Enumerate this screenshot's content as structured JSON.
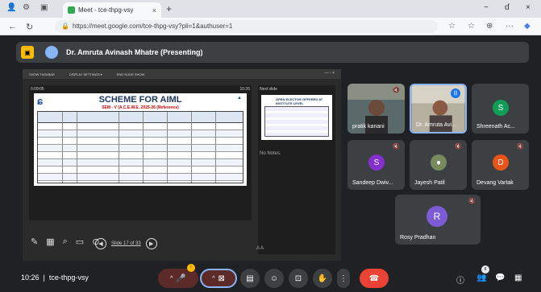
{
  "browser": {
    "tab_title": "Meet - tce-thpg-vsy",
    "tab_close": "×",
    "new_tab": "+",
    "url": "https://meet.google.com/tce-thpg-vsy?pli=1&authuser=1",
    "win_min": "−",
    "win_max": "ɗ",
    "win_close": "×"
  },
  "meet": {
    "presenting_title": "Dr. Amruta Avinash Mhatre (Presenting)",
    "share_toolbar": [
      "SHOW TASKBAR",
      "DISPLAY SETTINGS ▾",
      "END SLIDE SHOW"
    ],
    "slide_time_left": "0:09:05",
    "slide_time_right": "10:26",
    "slide_title": "SCHEME FOR AIML",
    "slide_subtitle": "SEM - V (A.C.E.W.E. 2025-26 (Reference)",
    "next_slide_label": "Next slide",
    "next_slide_title": "OPEN ELECTIVE OFFERED AT INSTITUTE LEVEL",
    "notes": "No Notes.",
    "slide_counter": "Slide 17 of 33",
    "participants": [
      {
        "name": "pratik kanani",
        "type": "video"
      },
      {
        "name": "Dr. Amruta Avi...",
        "type": "video"
      },
      {
        "name": "Shreenath Ac...",
        "initial": "S",
        "color": "#0f9d58"
      },
      {
        "name": "Sandeep Dwiv...",
        "initial": "S",
        "color": "#8430ce"
      },
      {
        "name": "Jayesh Patil",
        "type": "photo"
      },
      {
        "name": "Devang Vartak",
        "initial": "D",
        "color": "#e8541a"
      },
      {
        "name": "Rosy Pradhan",
        "initial": "R",
        "color": "#7b5cd6"
      }
    ],
    "time": "10:26",
    "meeting_code": "tce-thpg-vsy",
    "people_count": "8",
    "raise_badge": "!"
  },
  "colors": {
    "end_call": "#ea4335",
    "mic_off": "#5c2b29",
    "accent_yellow": "#fbbc04"
  }
}
